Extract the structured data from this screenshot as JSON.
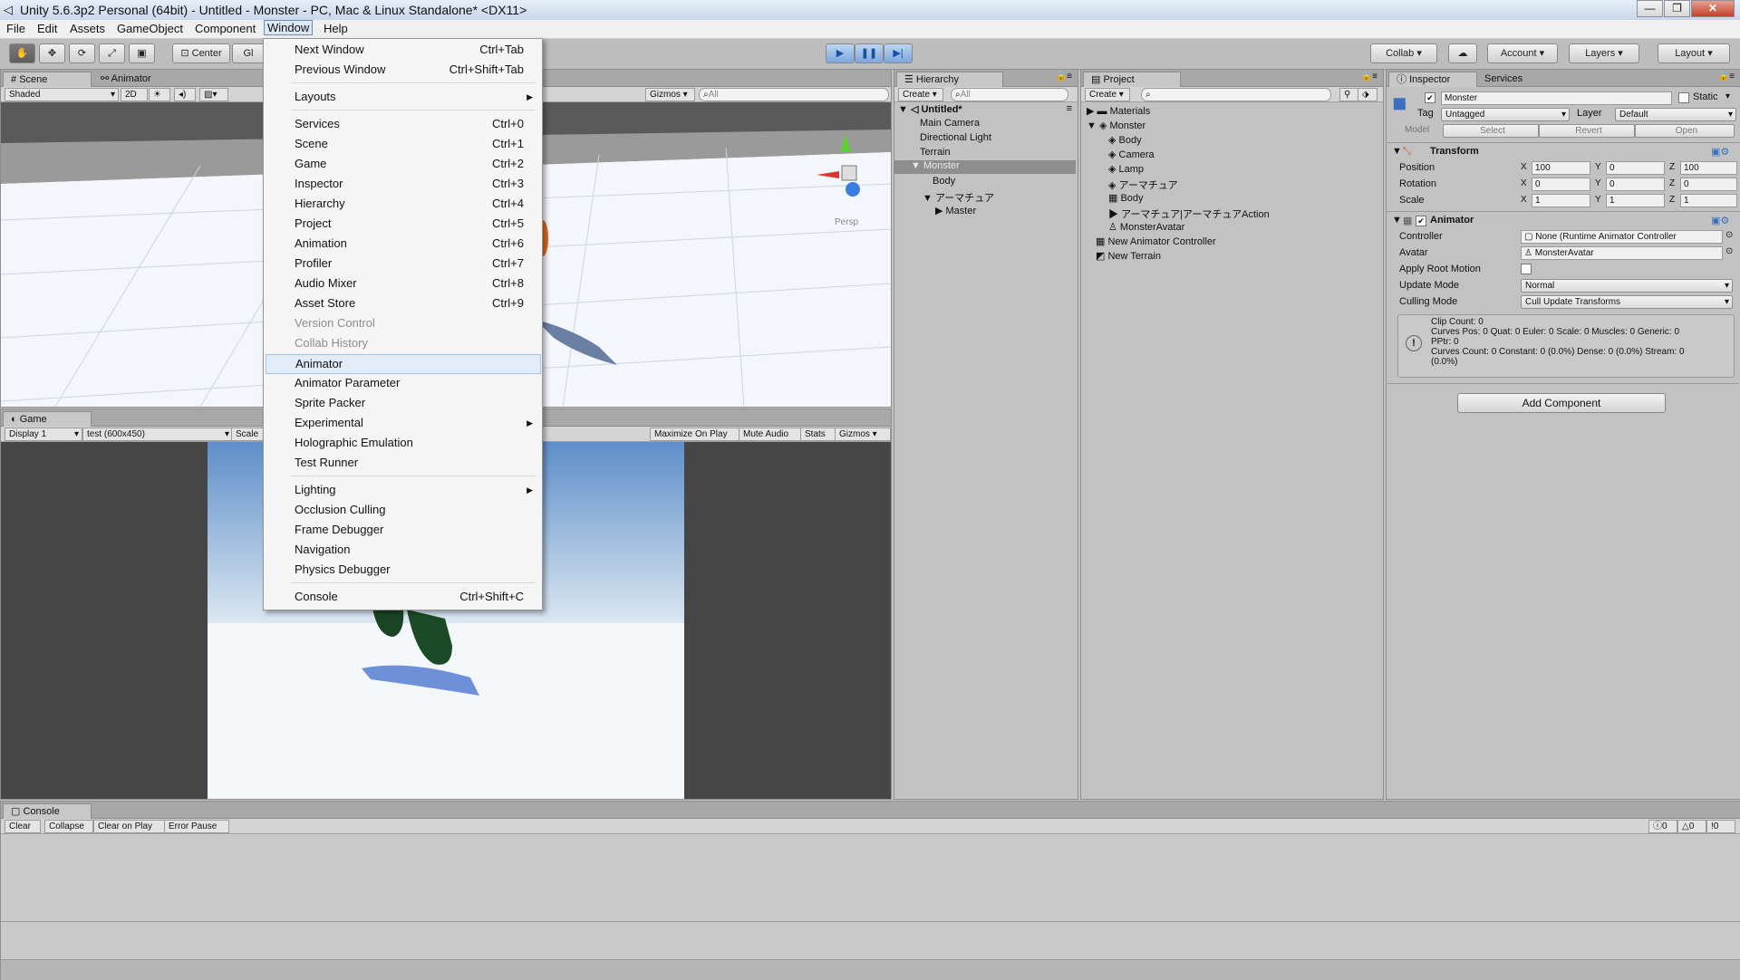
{
  "window": {
    "title": "Unity 5.6.3p2 Personal (64bit) - Untitled - Monster - PC, Mac & Linux Standalone* <DX11>",
    "controls": [
      "—",
      "❐",
      "✕"
    ]
  },
  "menubar": [
    "File",
    "Edit",
    "Assets",
    "GameObject",
    "Component",
    "Window",
    "Help"
  ],
  "toolbar": {
    "pivot": "Center",
    "global": "Gl",
    "collab": "Collab ▾",
    "account": "Account",
    "layers": "Layers",
    "layout": "Layout"
  },
  "window_menu": {
    "items": [
      {
        "label": "Next Window",
        "shortcut": "Ctrl+Tab"
      },
      {
        "label": "Previous Window",
        "shortcut": "Ctrl+Shift+Tab"
      },
      {
        "label": "Layouts",
        "submenu": true
      },
      {
        "label": "Services",
        "shortcut": "Ctrl+0"
      },
      {
        "label": "Scene",
        "shortcut": "Ctrl+1"
      },
      {
        "label": "Game",
        "shortcut": "Ctrl+2"
      },
      {
        "label": "Inspector",
        "shortcut": "Ctrl+3"
      },
      {
        "label": "Hierarchy",
        "shortcut": "Ctrl+4"
      },
      {
        "label": "Project",
        "shortcut": "Ctrl+5"
      },
      {
        "label": "Animation",
        "shortcut": "Ctrl+6"
      },
      {
        "label": "Profiler",
        "shortcut": "Ctrl+7"
      },
      {
        "label": "Audio Mixer",
        "shortcut": "Ctrl+8"
      },
      {
        "label": "Asset Store",
        "shortcut": "Ctrl+9"
      },
      {
        "label": "Version Control",
        "disabled": true
      },
      {
        "label": "Collab History",
        "disabled": true
      },
      {
        "label": "Animator",
        "highlighted": true
      },
      {
        "label": "Animator Parameter"
      },
      {
        "label": "Sprite Packer"
      },
      {
        "label": "Experimental",
        "submenu": true
      },
      {
        "label": "Holographic Emulation"
      },
      {
        "label": "Test Runner"
      },
      {
        "label": "Lighting",
        "submenu": true
      },
      {
        "label": "Occlusion Culling"
      },
      {
        "label": "Frame Debugger"
      },
      {
        "label": "Navigation"
      },
      {
        "label": "Physics Debugger"
      },
      {
        "label": "Console",
        "shortcut": "Ctrl+Shift+C"
      }
    ]
  },
  "scene": {
    "tabs": [
      "Scene",
      "Animator"
    ],
    "shading": "Shaded",
    "mode2d": "2D",
    "gizmos": "Gizmos",
    "search": "All",
    "persp": "Persp"
  },
  "game": {
    "tab": "Game",
    "display": "Display 1",
    "resolution": "test (600x450)",
    "scale": "Scale",
    "buttons": [
      "Maximize On Play",
      "Mute Audio",
      "Stats",
      "Gizmos"
    ]
  },
  "hierarchy": {
    "tab": "Hierarchy",
    "create": "Create",
    "search": "All",
    "scene_name": "Untitled*",
    "items": [
      {
        "label": "Main Camera",
        "depth": 1
      },
      {
        "label": "Directional Light",
        "depth": 1
      },
      {
        "label": "Terrain",
        "depth": 1
      },
      {
        "label": "Monster",
        "depth": 1,
        "selected": true,
        "expanded": true
      },
      {
        "label": "Body",
        "depth": 2
      },
      {
        "label": "アーマチュア",
        "depth": 2,
        "expanded": true
      },
      {
        "label": "Master",
        "depth": 3,
        "collapsed": true
      }
    ]
  },
  "project": {
    "tab": "Project",
    "create": "Create",
    "items": [
      {
        "label": "Materials",
        "depth": 0,
        "icon": "folder-icon",
        "collapsed": true
      },
      {
        "label": "Monster",
        "depth": 0,
        "icon": "model-icon",
        "expanded": true
      },
      {
        "label": "Body",
        "depth": 1,
        "icon": "mesh-icon"
      },
      {
        "label": "Camera",
        "depth": 1,
        "icon": "camera-icon"
      },
      {
        "label": "Lamp",
        "depth": 1,
        "icon": "lamp-icon"
      },
      {
        "label": "アーマチュア",
        "depth": 1,
        "icon": "bone-icon"
      },
      {
        "label": "Body",
        "depth": 1,
        "icon": "grid-icon"
      },
      {
        "label": "アーマチュア|アーマチュアAction",
        "depth": 1,
        "icon": "animation-clip-icon"
      },
      {
        "label": "MonsterAvatar",
        "depth": 1,
        "icon": "avatar-icon"
      },
      {
        "label": "New Animator Controller",
        "depth": 0,
        "icon": "animator-controller-icon"
      },
      {
        "label": "New Terrain",
        "depth": 0,
        "icon": "terrain-icon"
      }
    ]
  },
  "inspector": {
    "tabs": [
      "Inspector",
      "Services"
    ],
    "object_name": "Monster",
    "static_label": "Static",
    "tag_label": "Tag",
    "tag_value": "Untagged",
    "layer_label": "Layer",
    "layer_value": "Default",
    "model_label": "Model",
    "model_buttons": [
      "Select",
      "Revert",
      "Open"
    ],
    "transform": {
      "title": "Transform",
      "rows": [
        {
          "label": "Position",
          "x": "100",
          "y": "0",
          "z": "100"
        },
        {
          "label": "Rotation",
          "x": "0",
          "y": "0",
          "z": "0"
        },
        {
          "label": "Scale",
          "x": "1",
          "y": "1",
          "z": "1"
        }
      ]
    },
    "animator": {
      "title": "Animator",
      "controller_label": "Controller",
      "controller_value": "None (Runtime Animator Controller",
      "avatar_label": "Avatar",
      "avatar_value": "MonsterAvatar",
      "root_motion_label": "Apply Root Motion",
      "update_mode_label": "Update Mode",
      "update_mode_value": "Normal",
      "culling_mode_label": "Culling Mode",
      "culling_mode_value": "Cull Update Transforms",
      "info": [
        "Clip Count: 0",
        "Curves Pos: 0 Quat: 0 Euler: 0 Scale: 0 Muscles: 0 Generic: 0",
        "PPtr: 0",
        "Curves Count: 0 Constant: 0 (0.0%) Dense: 0 (0.0%) Stream: 0",
        "(0.0%)"
      ]
    },
    "add_component": "Add Component"
  },
  "console": {
    "tab": "Console",
    "buttons": [
      "Clear",
      "Collapse",
      "Clear on Play",
      "Error Pause"
    ],
    "counts": [
      "0",
      "0",
      "0"
    ]
  },
  "colors": {
    "panel": "#c2c2c2",
    "selection": "#8e8e8e",
    "menu_highlight": "#e2ecf8",
    "play_blue": "#2a64c8"
  }
}
